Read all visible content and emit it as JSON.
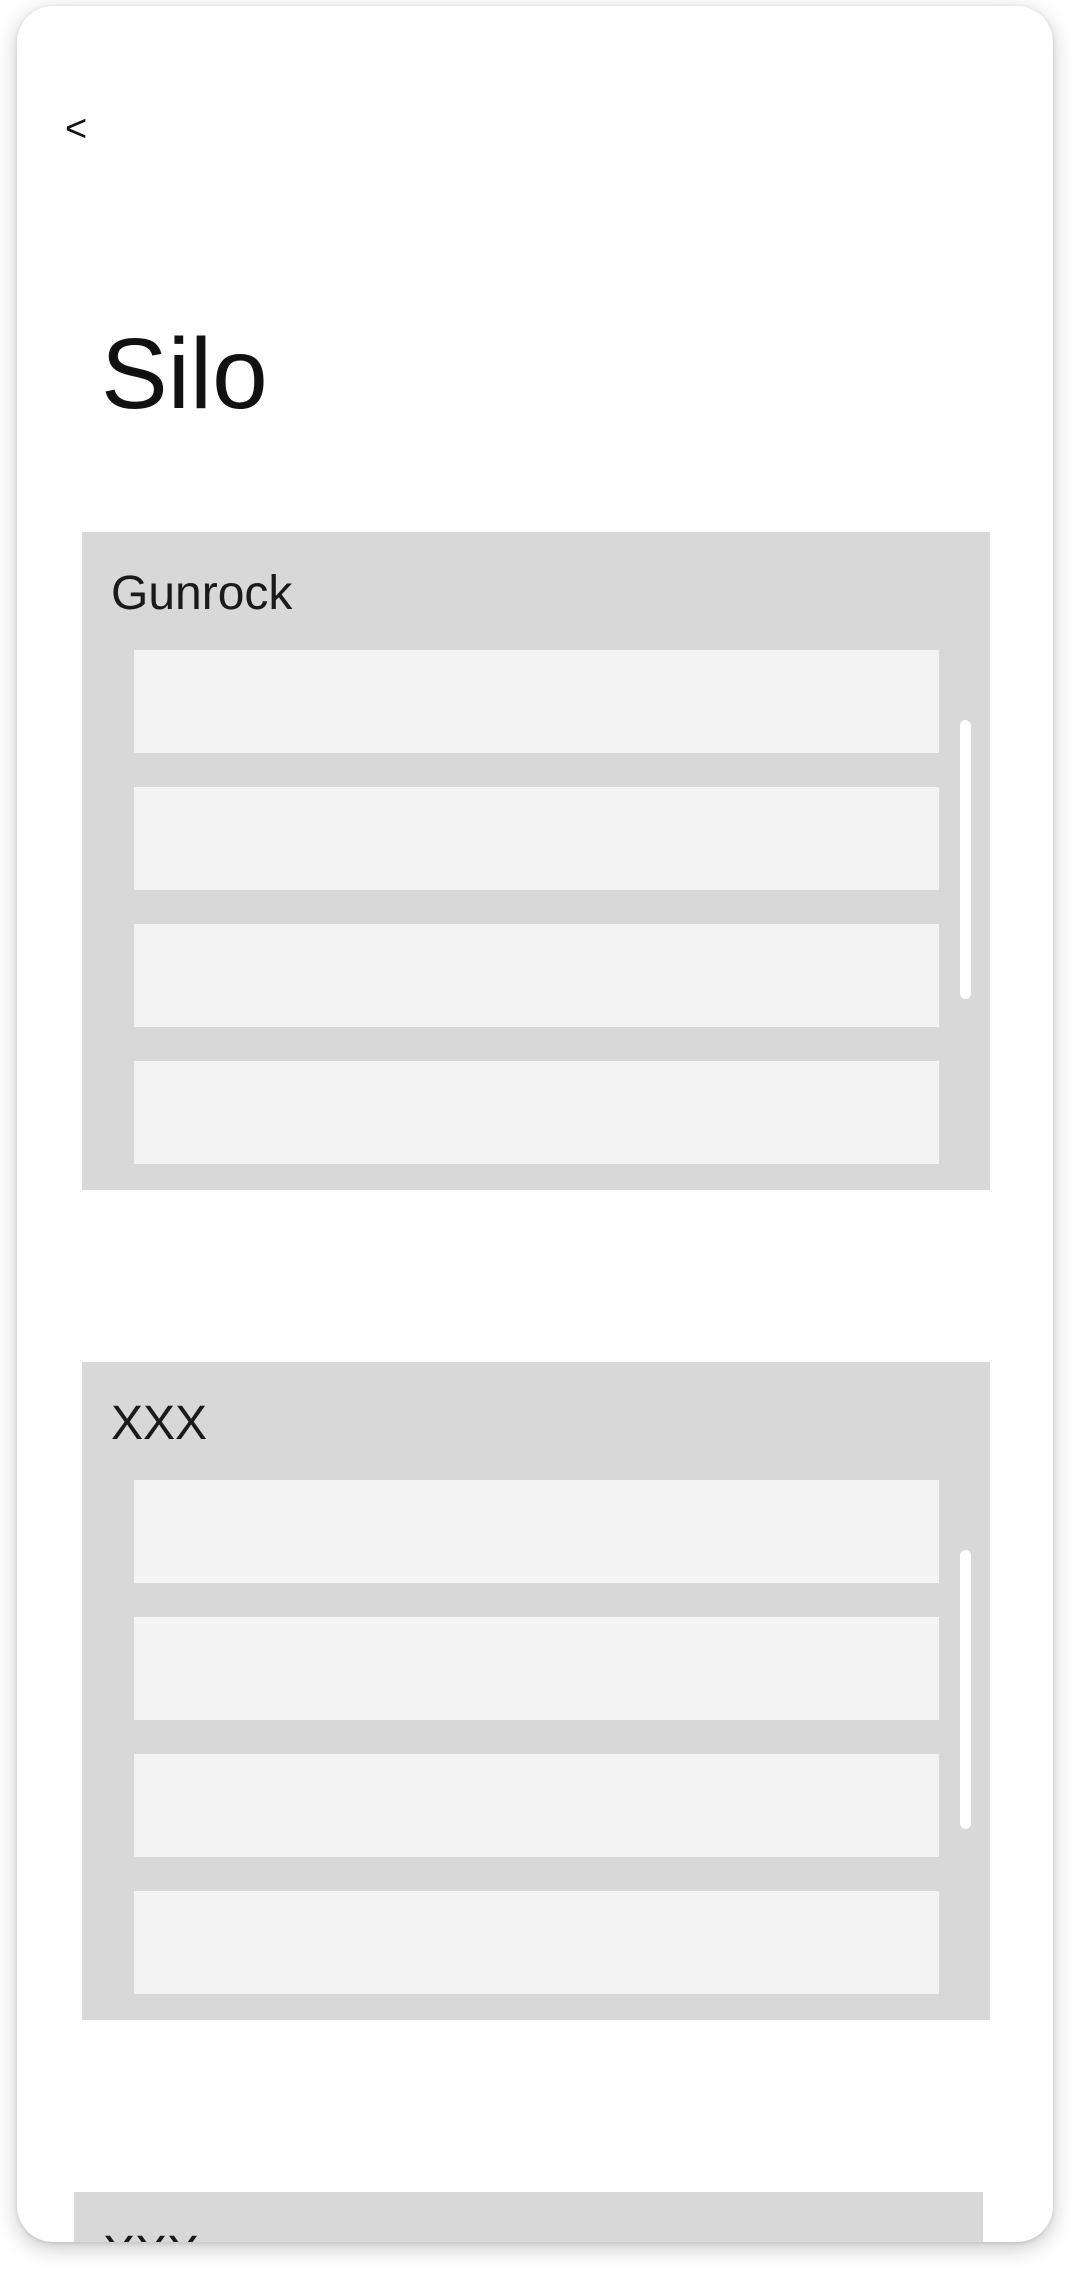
{
  "header": {
    "back_label": "<",
    "title": "Silo"
  },
  "sections": [
    {
      "title": "Gunrock",
      "rows": [
        "",
        "",
        "",
        ""
      ]
    },
    {
      "title": "XXX",
      "rows": [
        "",
        "",
        "",
        ""
      ]
    },
    {
      "title": "XXX"
    }
  ]
}
